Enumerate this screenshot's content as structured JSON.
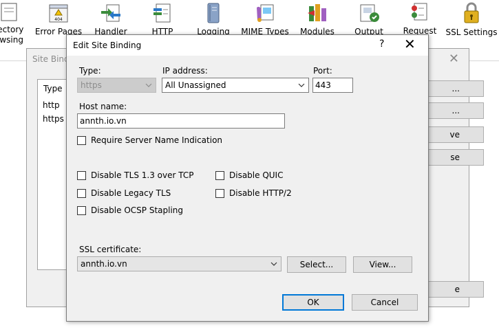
{
  "features": [
    {
      "id": "directory-browsing",
      "line1": "rectory",
      "line2": "owsing",
      "icon": "directory-browsing-icon"
    },
    {
      "id": "error-pages",
      "line1": "Error Pages",
      "line2": "",
      "icon": "error-pages-icon"
    },
    {
      "id": "handler",
      "line1": "Handler",
      "line2": "",
      "icon": "handler-mappings-icon"
    },
    {
      "id": "http",
      "line1": "HTTP",
      "line2": "",
      "icon": "http-headers-icon"
    },
    {
      "id": "logging",
      "line1": "Logging",
      "line2": "",
      "icon": "logging-icon"
    },
    {
      "id": "mime-types",
      "line1": "MIME Types",
      "line2": "",
      "icon": "mime-types-icon"
    },
    {
      "id": "modules",
      "line1": "Modules",
      "line2": "",
      "icon": "modules-icon"
    },
    {
      "id": "output",
      "line1": "Output",
      "line2": "",
      "icon": "output-caching-icon"
    },
    {
      "id": "request",
      "line1": "Request",
      "line2": "ing",
      "icon": "request-filtering-icon"
    },
    {
      "id": "ssl-settings",
      "line1": "SSL Settings",
      "line2": "",
      "icon": "ssl-lock-icon"
    }
  ],
  "error_icon_text": "404",
  "background_dialog": {
    "title": "Site Bindi",
    "list_header": "Type",
    "rows": [
      "http",
      "https"
    ],
    "buttons": [
      "...",
      "...",
      "ve",
      "se",
      "e"
    ]
  },
  "dialog": {
    "title": "Edit Site Binding",
    "help": "?",
    "close": "✕",
    "type_label": "Type:",
    "type_value": "https",
    "ip_label": "IP address:",
    "ip_value": "All Unassigned",
    "port_label": "Port:",
    "port_value": "443",
    "host_label": "Host name:",
    "host_value": "annth.io.vn",
    "sni_label": "Require Server Name Indication",
    "tls13_label": "Disable TLS 1.3 over TCP",
    "quic_label": "Disable QUIC",
    "legacy_tls_label": "Disable Legacy TLS",
    "http2_label": "Disable HTTP/2",
    "ocsp_label": "Disable OCSP Stapling",
    "ssl_label": "SSL certificate:",
    "ssl_value": "annth.io.vn",
    "select_button": "Select...",
    "view_button": "View...",
    "ok_button": "OK",
    "cancel_button": "Cancel"
  },
  "colors": {
    "dialog_bg": "#f0f0f0",
    "accent": "#0078d7",
    "button_bg": "#e1e1e1"
  }
}
